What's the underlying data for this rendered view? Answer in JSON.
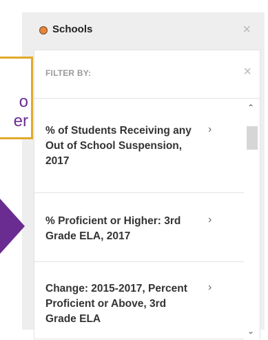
{
  "callout": {
    "line1": "o",
    "line2": "er"
  },
  "panel": {
    "title": "Schools",
    "close_icon": "×",
    "status_color": "#e8863a"
  },
  "filter": {
    "label": "FILTER BY:",
    "close_icon": "×",
    "items": [
      {
        "label": "% of Students Receiving any Out of School Suspension, 2017",
        "chevron": "›"
      },
      {
        "label": "% Proficient or Higher: 3rd Grade ELA, 2017",
        "chevron": "›"
      },
      {
        "label": "Change: 2015-2017, Percent Proficient or Above, 3rd Grade ELA",
        "chevron": "›"
      }
    ]
  },
  "scrollbar": {
    "up_icon": "⌃",
    "down_icon": "⌄"
  },
  "colors": {
    "accent_purple": "#6b2c91",
    "callout_border": "#e1a92a"
  }
}
